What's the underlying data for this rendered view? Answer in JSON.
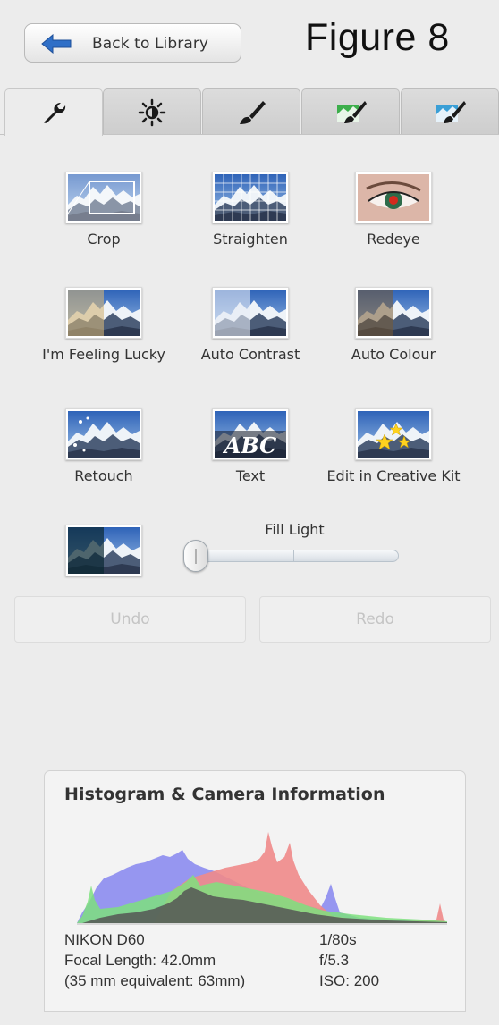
{
  "header": {
    "back_label": "Back to Library",
    "figure_title": "Figure 8"
  },
  "tabs": [
    {
      "icon": "wrench-icon",
      "active": true
    },
    {
      "icon": "brightness-icon",
      "active": false
    },
    {
      "icon": "paintbrush-icon",
      "active": false
    },
    {
      "icon": "landscape-brush-green-icon",
      "active": false
    },
    {
      "icon": "landscape-brush-blue-icon",
      "active": false
    }
  ],
  "tools": {
    "crop": "Crop",
    "straighten": "Straighten",
    "redeye": "Redeye",
    "lucky": "I'm Feeling Lucky",
    "auto_contrast": "Auto Contrast",
    "auto_colour": "Auto Colour",
    "retouch": "Retouch",
    "text": "Text",
    "text_thumb": "ABC",
    "creative_kit": "Edit in Creative Kit"
  },
  "fill_light": {
    "label": "Fill Light",
    "value": 0
  },
  "actions": {
    "undo": "Undo",
    "redo": "Redo"
  },
  "histogram": {
    "title": "Histogram & Camera Information",
    "colors": {
      "red": "#f08a8a",
      "green": "#7ee07e",
      "blue": "#8c8cf0",
      "gray": "#555555"
    }
  },
  "camera": {
    "model": "NIKON D60",
    "focal_length": "Focal Length: 42.0mm",
    "equivalent": "(35 mm equivalent:  63mm)",
    "shutter": "1/80s",
    "aperture": "f/5.3",
    "iso": "ISO: 200"
  },
  "colors": {
    "accent_arrow": "#2f6fc7",
    "background": "#ececec"
  }
}
